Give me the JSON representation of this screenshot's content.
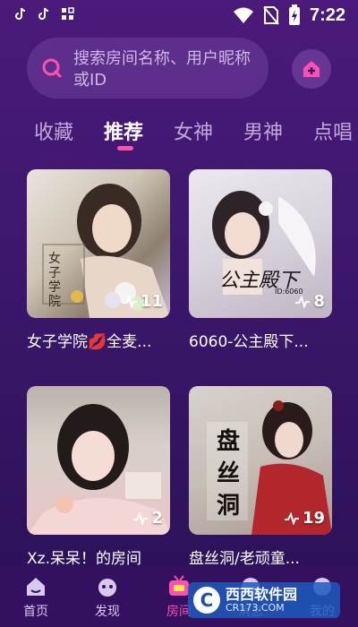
{
  "status_bar": {
    "time": "7:22"
  },
  "search": {
    "placeholder": "搜索房间名称、用户昵称或ID"
  },
  "tabs": [
    {
      "label": "收藏"
    },
    {
      "label": "推荐"
    },
    {
      "label": "女神"
    },
    {
      "label": "男神"
    },
    {
      "label": "点唱"
    }
  ],
  "active_tab": "推荐",
  "rooms": [
    {
      "title": "女子学院💋全麦...",
      "count": "11",
      "cover_text": "女子学院"
    },
    {
      "title": "6060-公主殿下...",
      "count": "8",
      "cover_text": "公主殿下",
      "cover_sub": "ID:6060"
    },
    {
      "title": "Xz.呆呆！的房间",
      "count": "2"
    },
    {
      "title": "盘丝洞/老顽童...",
      "count": "19",
      "cover_text": "盘丝洞"
    }
  ],
  "nav": [
    {
      "label": "首页"
    },
    {
      "label": "发现"
    },
    {
      "label": "房间"
    },
    {
      "label": "消息"
    },
    {
      "label": "我的"
    }
  ],
  "watermark": {
    "name": "西西软件园",
    "domain": "CR173.COM",
    "logo_letter": "C"
  },
  "colors": {
    "accent": "#ff4fb0",
    "background": "#3b176b"
  }
}
